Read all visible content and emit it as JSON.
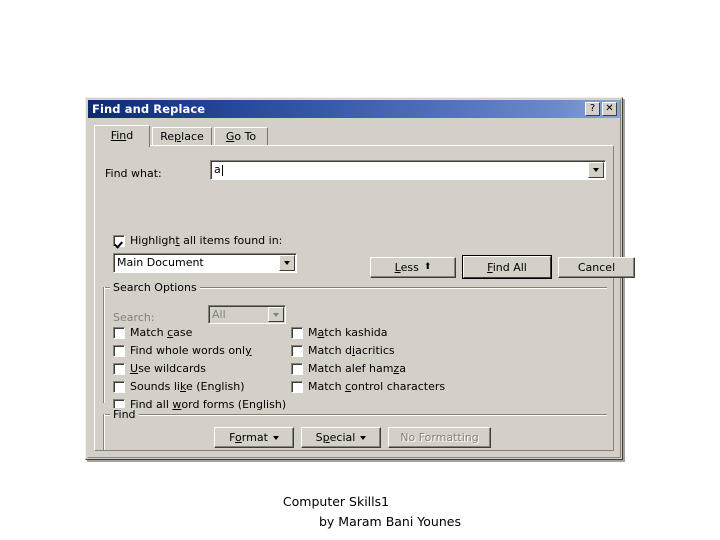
{
  "dialog": {
    "title": "Find and Replace",
    "titlebar_buttons": [
      {
        "name": "help-button",
        "glyph": "?"
      },
      {
        "name": "close-button",
        "glyph": "✕"
      }
    ],
    "tabs": [
      {
        "label": "Find",
        "active": true
      },
      {
        "label": "Replace",
        "active": false
      },
      {
        "label": "Go To",
        "active": false
      }
    ],
    "find_what": {
      "label": "Find what:",
      "value": "a",
      "placeholder": ""
    },
    "highlight": {
      "label": "Highlight all items found in:",
      "checked": true,
      "scope_value": "Main Document"
    },
    "action_buttons": {
      "less": "Less",
      "less_glyph": "⬆",
      "find_all": "Find All",
      "cancel": "Cancel"
    },
    "search_options": {
      "group_title": "Search Options",
      "search_label": "Search:",
      "search_value": "All",
      "search_disabled": true,
      "left_checkboxes": [
        {
          "label": "Match case",
          "checked": false
        },
        {
          "label": "Find whole words only",
          "checked": false
        },
        {
          "label": "Use wildcards",
          "checked": false
        },
        {
          "label": "Sounds like (English)",
          "checked": false
        },
        {
          "label": "Find all word forms (English)",
          "checked": false
        }
      ],
      "right_checkboxes": [
        {
          "label": "Match kashida",
          "checked": false
        },
        {
          "label": "Match diacritics",
          "checked": false
        },
        {
          "label": "Match alef hamza",
          "checked": false
        },
        {
          "label": "Match control characters",
          "checked": false
        }
      ]
    },
    "find_group": {
      "group_title": "Find",
      "format": "Format",
      "special": "Special",
      "no_formatting": "No Formatting",
      "no_formatting_disabled": true
    }
  },
  "footer": {
    "line1": "Computer Skills1",
    "line2": "by Maram Bani Younes"
  },
  "colors": {
    "dialog_face": "#d4d0c8",
    "titlebar_start": "#0b2a74",
    "titlebar_end": "#8aa5d6",
    "field_bg": "#ffffff",
    "disabled_text": "#83817c"
  }
}
